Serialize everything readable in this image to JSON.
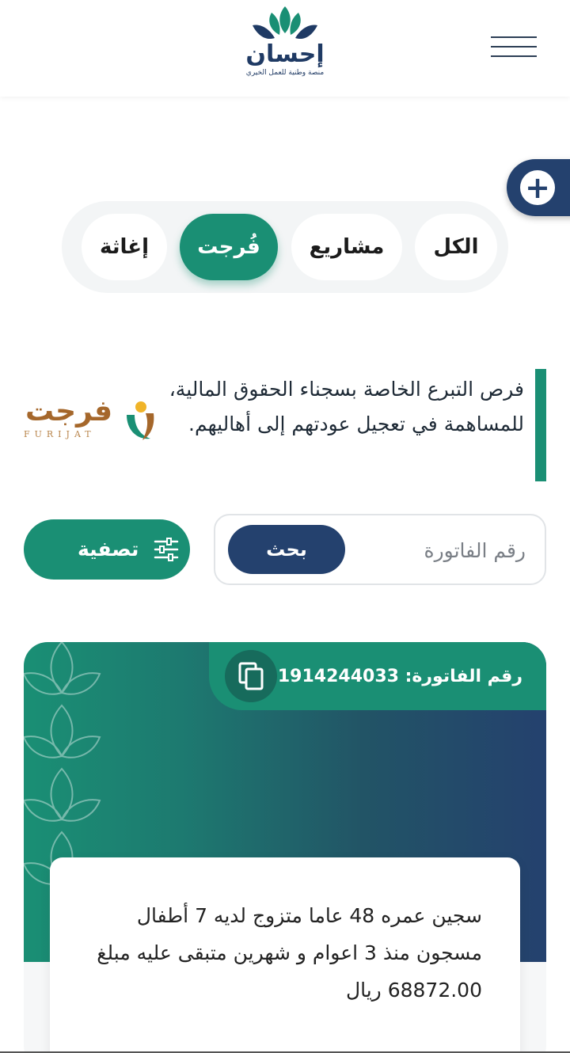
{
  "header": {
    "logo_name": "إحسان",
    "logo_tagline": "منصة وطنية للعمل الخيري",
    "menu_icon": "hamburger-icon"
  },
  "fab": {
    "icon": "plus-icon",
    "label": "+"
  },
  "tabs": [
    {
      "label": "الكل",
      "active": false
    },
    {
      "label": "مشاريع",
      "active": false
    },
    {
      "label": "فُرجت",
      "active": true
    },
    {
      "label": "إغاثة",
      "active": false
    }
  ],
  "intro": {
    "text": "فرص التبرع الخاصة بسجناء الحقوق المالية، للمساهمة في تعجيل عودتهم إلى أهاليهم.",
    "logo_word": "فرجت",
    "logo_sub": "FURIJAT"
  },
  "search": {
    "placeholder": "رقم الفاتورة",
    "button": "بحث"
  },
  "filter": {
    "label": "تصفية",
    "icon": "sliders-icon"
  },
  "card": {
    "invoice_label": "رقم الفاتورة:",
    "invoice_number": "1914244033",
    "copy_icon": "copy-icon",
    "description": "سجين عمره 48 عاما متزوج لديه 7 أطفال مسجون منذ 3 اعوام و شهرين متبقى عليه مبلغ 68872.00 ريال"
  },
  "colors": {
    "primary_green": "#1a8f74",
    "navy": "#24416e"
  }
}
